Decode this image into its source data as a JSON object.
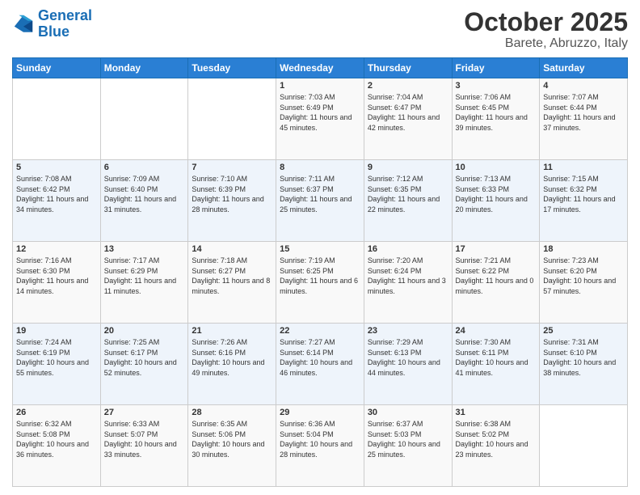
{
  "logo": {
    "line1": "General",
    "line2": "Blue"
  },
  "title": "October 2025",
  "subtitle": "Barete, Abruzzo, Italy",
  "days_header": [
    "Sunday",
    "Monday",
    "Tuesday",
    "Wednesday",
    "Thursday",
    "Friday",
    "Saturday"
  ],
  "weeks": [
    [
      {
        "day": "",
        "sunrise": "",
        "sunset": "",
        "daylight": ""
      },
      {
        "day": "",
        "sunrise": "",
        "sunset": "",
        "daylight": ""
      },
      {
        "day": "",
        "sunrise": "",
        "sunset": "",
        "daylight": ""
      },
      {
        "day": "1",
        "sunrise": "Sunrise: 7:03 AM",
        "sunset": "Sunset: 6:49 PM",
        "daylight": "Daylight: 11 hours and 45 minutes."
      },
      {
        "day": "2",
        "sunrise": "Sunrise: 7:04 AM",
        "sunset": "Sunset: 6:47 PM",
        "daylight": "Daylight: 11 hours and 42 minutes."
      },
      {
        "day": "3",
        "sunrise": "Sunrise: 7:06 AM",
        "sunset": "Sunset: 6:45 PM",
        "daylight": "Daylight: 11 hours and 39 minutes."
      },
      {
        "day": "4",
        "sunrise": "Sunrise: 7:07 AM",
        "sunset": "Sunset: 6:44 PM",
        "daylight": "Daylight: 11 hours and 37 minutes."
      }
    ],
    [
      {
        "day": "5",
        "sunrise": "Sunrise: 7:08 AM",
        "sunset": "Sunset: 6:42 PM",
        "daylight": "Daylight: 11 hours and 34 minutes."
      },
      {
        "day": "6",
        "sunrise": "Sunrise: 7:09 AM",
        "sunset": "Sunset: 6:40 PM",
        "daylight": "Daylight: 11 hours and 31 minutes."
      },
      {
        "day": "7",
        "sunrise": "Sunrise: 7:10 AM",
        "sunset": "Sunset: 6:39 PM",
        "daylight": "Daylight: 11 hours and 28 minutes."
      },
      {
        "day": "8",
        "sunrise": "Sunrise: 7:11 AM",
        "sunset": "Sunset: 6:37 PM",
        "daylight": "Daylight: 11 hours and 25 minutes."
      },
      {
        "day": "9",
        "sunrise": "Sunrise: 7:12 AM",
        "sunset": "Sunset: 6:35 PM",
        "daylight": "Daylight: 11 hours and 22 minutes."
      },
      {
        "day": "10",
        "sunrise": "Sunrise: 7:13 AM",
        "sunset": "Sunset: 6:33 PM",
        "daylight": "Daylight: 11 hours and 20 minutes."
      },
      {
        "day": "11",
        "sunrise": "Sunrise: 7:15 AM",
        "sunset": "Sunset: 6:32 PM",
        "daylight": "Daylight: 11 hours and 17 minutes."
      }
    ],
    [
      {
        "day": "12",
        "sunrise": "Sunrise: 7:16 AM",
        "sunset": "Sunset: 6:30 PM",
        "daylight": "Daylight: 11 hours and 14 minutes."
      },
      {
        "day": "13",
        "sunrise": "Sunrise: 7:17 AM",
        "sunset": "Sunset: 6:29 PM",
        "daylight": "Daylight: 11 hours and 11 minutes."
      },
      {
        "day": "14",
        "sunrise": "Sunrise: 7:18 AM",
        "sunset": "Sunset: 6:27 PM",
        "daylight": "Daylight: 11 hours and 8 minutes."
      },
      {
        "day": "15",
        "sunrise": "Sunrise: 7:19 AM",
        "sunset": "Sunset: 6:25 PM",
        "daylight": "Daylight: 11 hours and 6 minutes."
      },
      {
        "day": "16",
        "sunrise": "Sunrise: 7:20 AM",
        "sunset": "Sunset: 6:24 PM",
        "daylight": "Daylight: 11 hours and 3 minutes."
      },
      {
        "day": "17",
        "sunrise": "Sunrise: 7:21 AM",
        "sunset": "Sunset: 6:22 PM",
        "daylight": "Daylight: 11 hours and 0 minutes."
      },
      {
        "day": "18",
        "sunrise": "Sunrise: 7:23 AM",
        "sunset": "Sunset: 6:20 PM",
        "daylight": "Daylight: 10 hours and 57 minutes."
      }
    ],
    [
      {
        "day": "19",
        "sunrise": "Sunrise: 7:24 AM",
        "sunset": "Sunset: 6:19 PM",
        "daylight": "Daylight: 10 hours and 55 minutes."
      },
      {
        "day": "20",
        "sunrise": "Sunrise: 7:25 AM",
        "sunset": "Sunset: 6:17 PM",
        "daylight": "Daylight: 10 hours and 52 minutes."
      },
      {
        "day": "21",
        "sunrise": "Sunrise: 7:26 AM",
        "sunset": "Sunset: 6:16 PM",
        "daylight": "Daylight: 10 hours and 49 minutes."
      },
      {
        "day": "22",
        "sunrise": "Sunrise: 7:27 AM",
        "sunset": "Sunset: 6:14 PM",
        "daylight": "Daylight: 10 hours and 46 minutes."
      },
      {
        "day": "23",
        "sunrise": "Sunrise: 7:29 AM",
        "sunset": "Sunset: 6:13 PM",
        "daylight": "Daylight: 10 hours and 44 minutes."
      },
      {
        "day": "24",
        "sunrise": "Sunrise: 7:30 AM",
        "sunset": "Sunset: 6:11 PM",
        "daylight": "Daylight: 10 hours and 41 minutes."
      },
      {
        "day": "25",
        "sunrise": "Sunrise: 7:31 AM",
        "sunset": "Sunset: 6:10 PM",
        "daylight": "Daylight: 10 hours and 38 minutes."
      }
    ],
    [
      {
        "day": "26",
        "sunrise": "Sunrise: 6:32 AM",
        "sunset": "Sunset: 5:08 PM",
        "daylight": "Daylight: 10 hours and 36 minutes."
      },
      {
        "day": "27",
        "sunrise": "Sunrise: 6:33 AM",
        "sunset": "Sunset: 5:07 PM",
        "daylight": "Daylight: 10 hours and 33 minutes."
      },
      {
        "day": "28",
        "sunrise": "Sunrise: 6:35 AM",
        "sunset": "Sunset: 5:06 PM",
        "daylight": "Daylight: 10 hours and 30 minutes."
      },
      {
        "day": "29",
        "sunrise": "Sunrise: 6:36 AM",
        "sunset": "Sunset: 5:04 PM",
        "daylight": "Daylight: 10 hours and 28 minutes."
      },
      {
        "day": "30",
        "sunrise": "Sunrise: 6:37 AM",
        "sunset": "Sunset: 5:03 PM",
        "daylight": "Daylight: 10 hours and 25 minutes."
      },
      {
        "day": "31",
        "sunrise": "Sunrise: 6:38 AM",
        "sunset": "Sunset: 5:02 PM",
        "daylight": "Daylight: 10 hours and 23 minutes."
      },
      {
        "day": "",
        "sunrise": "",
        "sunset": "",
        "daylight": ""
      }
    ]
  ]
}
